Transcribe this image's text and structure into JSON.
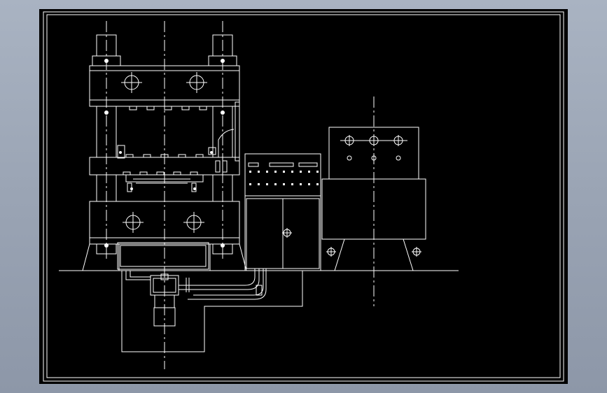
{
  "canvas": {
    "background": "#000000",
    "line_color": "#ffffff",
    "frame_background": "#a3adbd"
  },
  "drawing": {
    "subject": "press-front-elevation",
    "components": [
      "press-frame",
      "control-cabinet",
      "hydraulic-power-unit",
      "foundation-pit",
      "ground-line"
    ]
  }
}
